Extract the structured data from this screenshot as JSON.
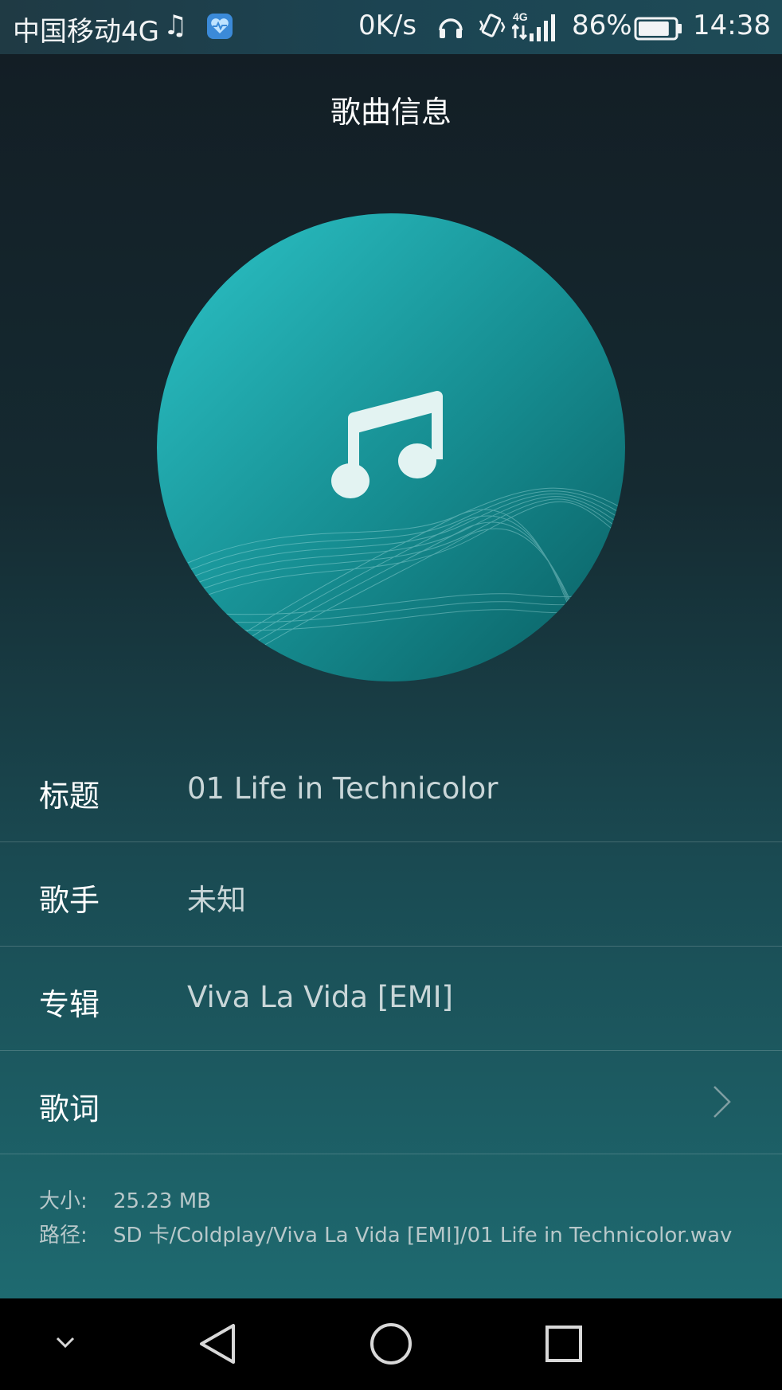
{
  "status_bar": {
    "carrier": "中国移动4G",
    "net_speed": "0K/s",
    "battery_percent": "86%",
    "battery_level": 0.86,
    "time": "14:38",
    "network_type": "4G"
  },
  "page": {
    "title": "歌曲信息"
  },
  "info": {
    "rows": [
      {
        "label": "标题",
        "value": "01 Life in Technicolor"
      },
      {
        "label": "歌手",
        "value": "未知"
      },
      {
        "label": "专辑",
        "value": "Viva La Vida [EMI]"
      },
      {
        "label": "歌词",
        "value": ""
      }
    ]
  },
  "file": {
    "size_label": "大小:",
    "size_value": "25.23 MB",
    "path_label": "路径:",
    "path_value": "SD 卡/Coldplay/Viva La Vida [EMI]/01 Life in Technicolor.wav"
  },
  "icons": {
    "album_art": "music-note-icon",
    "lyrics_arrow": "chevron-right-icon",
    "nav": [
      "chevron-down-icon",
      "back-triangle-icon",
      "home-circle-icon",
      "recents-square-icon"
    ]
  },
  "colors": {
    "accent": "#2ab5b9",
    "album_dark": "#0a5f63"
  }
}
